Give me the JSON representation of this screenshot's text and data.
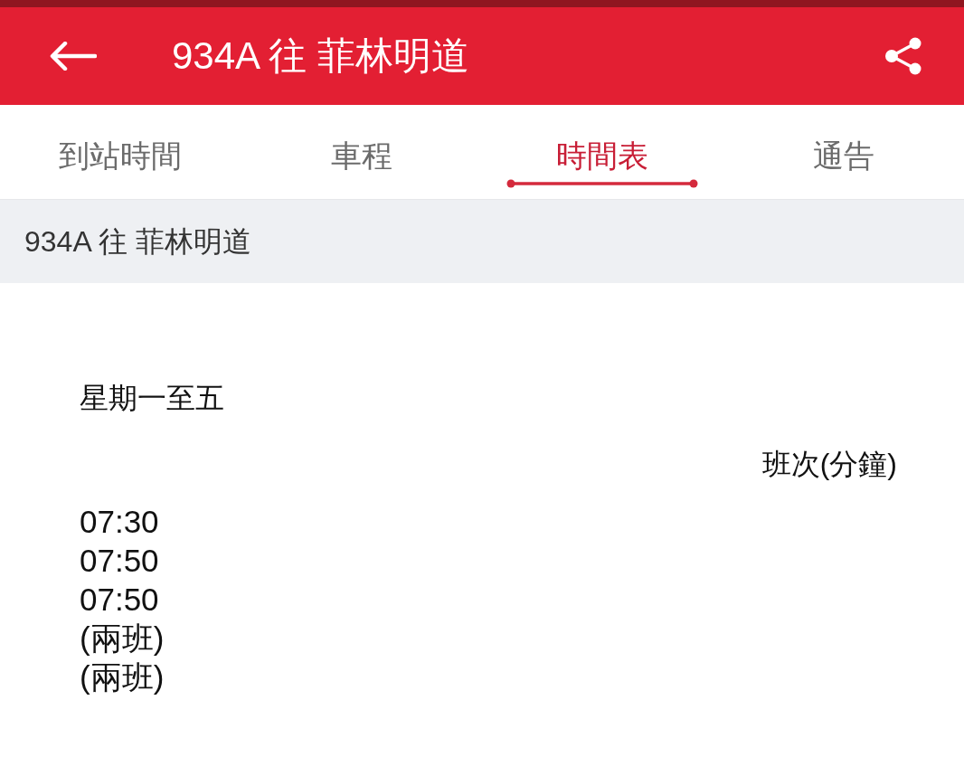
{
  "app_bar": {
    "title": "934A 往 菲林明道"
  },
  "tabs": [
    {
      "label": "到站時間",
      "selected": false
    },
    {
      "label": "車程",
      "selected": false
    },
    {
      "label": "時間表",
      "selected": true
    },
    {
      "label": "通告",
      "selected": false
    }
  ],
  "route_header": {
    "text": "934A 往 菲林明道"
  },
  "schedule": {
    "day_label": "星期一至五",
    "frequency_heading": "班次(分鐘)",
    "entries": [
      "07:30",
      "07:50",
      "07:50",
      "(兩班)",
      "(兩班)"
    ]
  }
}
